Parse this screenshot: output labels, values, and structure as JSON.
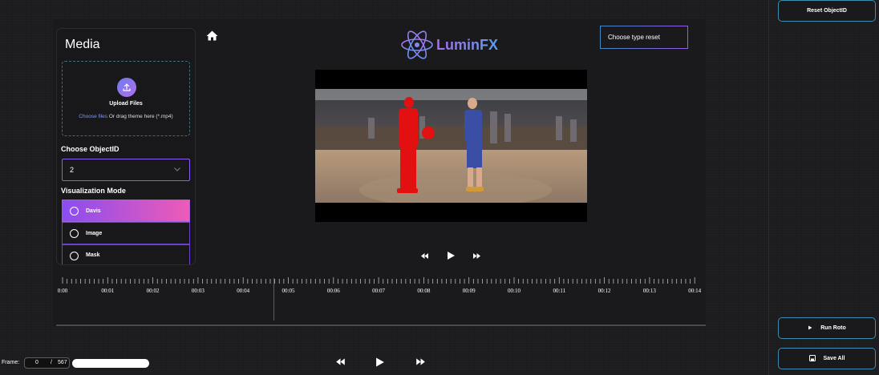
{
  "media": {
    "title": "Media",
    "upload_label": "Upload Files",
    "upload_link": "Choose files",
    "upload_hint": " Or drag theme here (*.mp4)",
    "choose_object_label": "Choose ObjectID",
    "object_value": "2",
    "vis_mode_label": "Visualization Mode",
    "modes": [
      "Davis",
      "Image",
      "Mask"
    ],
    "active_mode": "Davis"
  },
  "logo": {
    "text": "LuminFX"
  },
  "reset_type_select": "Choose type reset",
  "timeline": {
    "ticks": [
      "0:00",
      "00:01",
      "00:02",
      "00:03",
      "00:04",
      "00:05",
      "00:06",
      "00:07",
      "00:08",
      "00:09",
      "00:10",
      "00:11",
      "00:12",
      "00:13",
      "00:14"
    ],
    "playhead_time": "00:04.7"
  },
  "sidebar": {
    "reset_object_label": "Reset ObjectID",
    "run_roto_label": "Run Roto",
    "save_all_label": "Save All"
  },
  "frame": {
    "label": "Frame:",
    "current": "0",
    "separator": "/",
    "total": "567"
  },
  "icons": [
    "home-icon",
    "upload-icon",
    "chevron-down-icon",
    "rewind-icon",
    "play-icon",
    "fast-forward-icon",
    "save-icon"
  ],
  "colors": {
    "accent_purple": "#8a5cf0",
    "accent_pink": "#ee5bb6",
    "accent_teal": "#3a8fb0",
    "playhead": "#3b53d8"
  }
}
